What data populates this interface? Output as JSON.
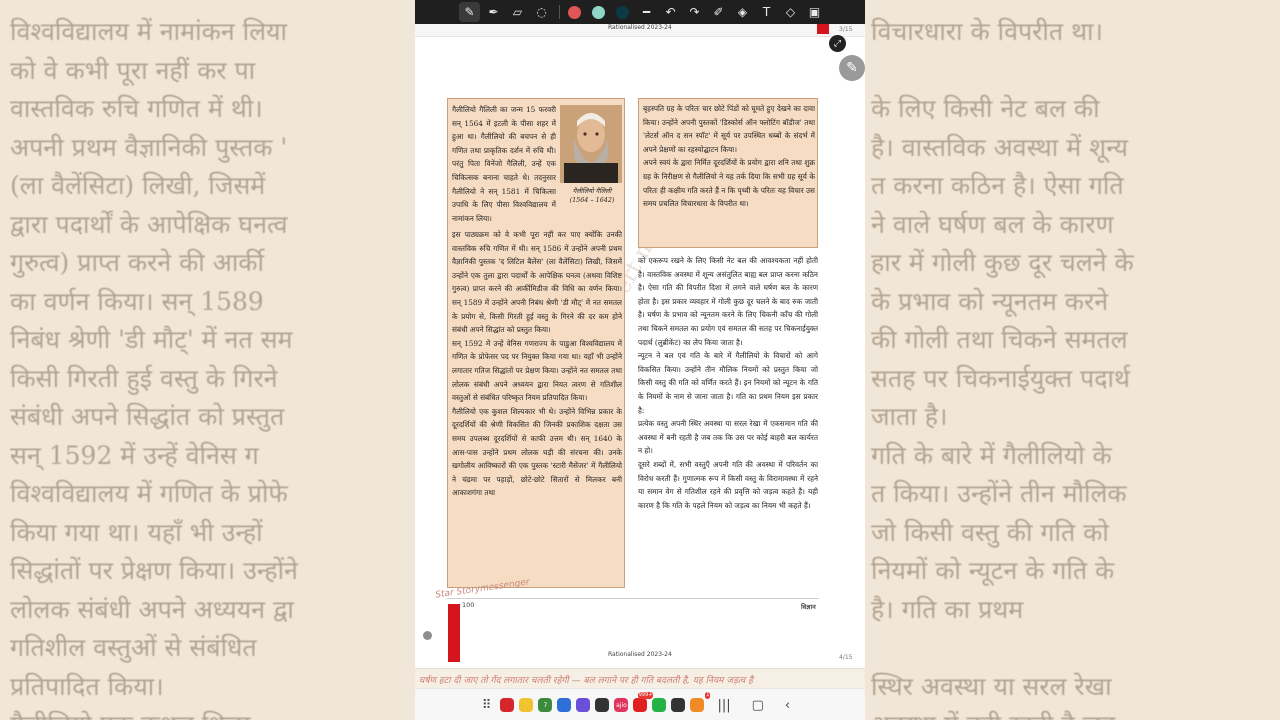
{
  "toolbar": {
    "tools": [
      {
        "name": "pen-icon",
        "glyph": "✎"
      },
      {
        "name": "highlighter-icon",
        "glyph": "✒"
      },
      {
        "name": "eraser-icon",
        "glyph": "▱"
      },
      {
        "name": "lasso-icon",
        "glyph": "◌"
      }
    ],
    "colors": [
      "#e05555",
      "#8fd8c8",
      "#0b3a44"
    ],
    "actions": [
      {
        "name": "line-width-icon",
        "glyph": "━"
      },
      {
        "name": "undo-icon",
        "glyph": "↶"
      },
      {
        "name": "redo-icon",
        "glyph": "↷"
      },
      {
        "name": "marker-icon",
        "glyph": "✐"
      },
      {
        "name": "ink-icon",
        "glyph": "◈"
      },
      {
        "name": "text-box-icon",
        "glyph": "T"
      },
      {
        "name": "shapes-icon",
        "glyph": "◇"
      },
      {
        "name": "page-icon",
        "glyph": "▣"
      }
    ]
  },
  "page": {
    "top_rationalised": "Rationalised 2023-24",
    "top_page_count": "3/15",
    "bottom_page_count": "4/15",
    "bottom_rationalised": "Rationalised 2023-24",
    "page_number": "100",
    "subject": "विज्ञान",
    "caption_name": "गैलीलियो गैलिली",
    "caption_years": "(1564 – 1642)",
    "box_left_intro": "गैलीलियो गैलिली का जन्म 15 फरवरी सन् 1564 में इटली के पीसा शहर में हुआ था। गैलीलियो की बचपन से ही गणित तथा प्राकृतिक दर्शन में रुचि थी। परंतु पिता विनेंजो गैलिली, उन्हें एक चिकित्सक बनाना चाहते थे। तदनुसार गैलीलियो ने सन् 1581 में चिकित्सा उपाधि के लिए पीसा विश्वविद्यालय में नामांकन लिया।",
    "box_left_main": "इस पाठ्यक्रम को वे कभी पूरा नहीं कर पाए क्योंकि उनकी वास्तविक रुचि गणित में थी। सन् 1586 में उन्होंने अपनी प्रथम वैज्ञानिकी पुस्तक 'द लिटिल बैलेंस' (ला वैलेंसिटा) लिखी, जिसमें उन्होंने एक तुला द्वारा पदार्थों के आपेक्षिक घनत्व (अथवा विशिष्ट गुरुत्व) प्राप्त करने की आर्कीमिडीज की विधि का वर्णन किया। सन् 1589 में उन्होंने अपनी निबंध श्रेणी 'डी मौट्' में नत समतल के प्रयोग से, किसी गिरती हुई वस्तु के गिरने की दर कम होने संबंधी अपने सिद्धांत को प्रस्तुत किया।\n  सन् 1592 में उन्हें वेनिस गणराज्य के पाडुआ विश्वविद्यालय में गणित के प्रोफेसर पद पर नियुक्त किया गया था। यहाँ भी उन्होंने लगातार गतिज सिद्धांतों पर प्रेक्षण किया। उन्होंने नत समतल तथा लोलक संबंधी अपने अध्ययन द्वारा नियत त्वरण से गतिशील वस्तुओं से संबंधित परिष्कृत नियम प्रतिपादित किया।\n  गैलीलियो एक कुशल शिल्पकार भी थे। उन्होंने विभिन्न प्रकार के दूरदर्शियों की श्रेणी विकसित की जिनकी प्रकाशिक दक्षता उस समय उपलब्ध दूरदर्शियों से काफी उत्तम थी। सन् 1640 के आस-पास उन्होंने प्रथम लोलक घड़ी की संरचना की। उनके खगोलीय आविष्कारों की एक पुस्तक 'स्टारी मैसेंजर' में गैलीलियो ने चंद्रमा पर पहाड़ों, छोटे-छोटे सितारों से मिलकर बनी आकाशगंगा तथा",
    "box_right": "बृहस्पति ग्रह के परितः चार छोटे पिंडों को घूमते हुए देखने का दावा किया। उन्होंने अपनी पुस्तकों 'डिस्कोर्स ऑन फ्लोटिंग बॉडीज' तथा 'लेटर्स ऑन द सन स्पॉट' में सूर्य पर उपस्थित धब्बों के संदर्भ में अपने प्रेक्षणों का रहस्योद्घाटन किया।\n  अपने स्वयं के द्वारा निर्मित दूरदर्शियों के प्रयोग द्वारा शनि तथा शुक्र ग्रह के निरीक्षण से गैलीलियो ने यह तर्क दिया कि सभी ग्रह सूर्य के परितः ही कक्षीय गति करते हैं न कि पृथ्वी के परितः यह विचार उस समय प्रचलित विचारधारा के विपरीत था।",
    "right_col_text": "को एकरूप रखने के लिए किसी नेट बल की आवश्यकता नहीं होती है। वास्तविक अवस्था में शून्य असंतुलित बाह्य बल प्राप्त करना कठिन है। ऐसा गति की विपरीत दिशा में लगने वाले घर्षण बल के कारण होता है। इस प्रकार व्यवहार में गोली कुछ दूर चलने के बाद रुक जाती है। घर्षण के प्रभाव को न्यूनतम करने के लिए चिकनी काँच की गोली तथा चिकने समतल का प्रयोग एवं समतल की सतह पर चिकनाईयुक्त पदार्थ (लुब्रीकेंट) का लेप किया जाता है।\n  न्यूटन ने बल एवं गति के बारे में गैलीलियो के विचारों को आगे विकसित किया। उन्होंने तीन मौलिक नियमों को प्रस्तुत किया जो किसी वस्तु की गति को वर्णित करते हैं। इन नियमों को न्यूटन के गति के नियमों के नाम से जाना जाता है। गति का प्रथम नियम इस प्रकार है:\n  प्रत्येक वस्तु अपनी स्थिर अवस्था या सरल रेखा में एकसमान गति की अवस्था में बनी रहती है जब तक कि उस पर कोई बाहरी बल कार्यरत न हो।\n  दूसरे शब्दों में, सभी वस्तुएँ अपनी गति की अवस्था में परिवर्तन का विरोध करती हैं। गुणात्मक रूप में किसी वस्तु के विरामावस्था में रहने या समान वेग से गतिशील रहने की प्रवृत्ति को जड़त्व कहते हैं। यही कारण है कि गति के पहले नियम को जड़त्व का नियम भी कहते हैं।",
    "handwriting_sig": "Star Storymessenger",
    "handwriting_bottom": "घर्षण हटा दी जाए तो गेंद लगातार चलती रहेगी — बल लगाने पर ही गति बदलती है, यह नियम जड़त्व है"
  },
  "left_blur_lines": [
    "विश्वविद्यालय में नामांकन लिया",
    "को वे कभी पूरा नहीं कर पा",
    "वास्तविक रुचि गणित में थी।",
    "अपनी प्रथम वैज्ञानिकी पुस्तक '",
    "(ला वैलेंसिटा) लिखी, जिसमें",
    "द्वारा पदार्थों के आपेक्षिक घनत्व",
    "गुरुत्व) प्राप्त करने की आर्की",
    "का वर्णन किया। सन् 1589",
    "निबंध श्रेणी 'डी मौट्' में नत सम",
    "किसी गिरती हुई वस्तु के गिरने",
    "संबंधी अपने सिद्धांत को प्रस्तुत",
    "   सन् 1592 में उन्हें वेनिस ग",
    "विश्वविद्यालय में गणित के प्रोफे",
    "किया गया था। यहाँ भी उन्हों",
    "सिद्धांतों पर प्रेक्षण किया। उन्होंने",
    "लोलक संबंधी अपने अध्ययन द्वा",
    "गतिशील वस्तुओं से संबंधित",
    "प्रतिपादित किया।",
    "   गैलीलियो एक कुशल शिल्प"
  ],
  "right_blur_lines": [
    "विचारधारा के विपरीत था।",
    "",
    "के लिए किसी नेट बल की",
    "है। वास्तविक अवस्था में शून्य",
    "त करना कठिन है। ऐसा गति",
    "ने वाले घर्षण बल के कारण",
    "हार में गोली कुछ दूर चलने के",
    "के प्रभाव को न्यूनतम करने",
    "की गोली तथा चिकने समतल",
    "सतह पर चिकनाईयुक्त पदार्थ",
    "जाता है।",
    "गति के बारे में गैलीलियो के",
    "त किया। उन्होंने तीन मौलिक",
    "जो किसी वस्तु की गति को",
    "नियमों को न्यूटन के गति के",
    "है। गति का प्रथम",
    "",
    "स्थिर अवस्था या सरल रेखा",
    "अवस्था में बनी रहती है जब"
  ],
  "navbar": {
    "apps": [
      {
        "name": "app-red-icon",
        "color": "#d6262d"
      },
      {
        "name": "app-notes-icon",
        "color": "#f2c230"
      },
      {
        "name": "app-calendar-icon",
        "color": "#3b8a3e",
        "label": "7"
      },
      {
        "name": "app-messages-icon",
        "color": "#2f6fd8"
      },
      {
        "name": "app-browser-icon",
        "color": "#6a4fd8"
      },
      {
        "name": "app-camera-icon",
        "color": "#333333"
      },
      {
        "name": "app-jio-icon",
        "color": "#e0345c",
        "label": "ajio"
      },
      {
        "name": "app-youtube-icon",
        "color": "#e02020",
        "badge": "999+"
      },
      {
        "name": "app-whatsapp-icon",
        "color": "#25b244"
      },
      {
        "name": "app-settings-icon",
        "color": "#333333"
      },
      {
        "name": "app-photos-icon",
        "color": "#f08a24",
        "badge": "1"
      }
    ],
    "recents": "|||",
    "home": "▢",
    "back": "‹"
  }
}
